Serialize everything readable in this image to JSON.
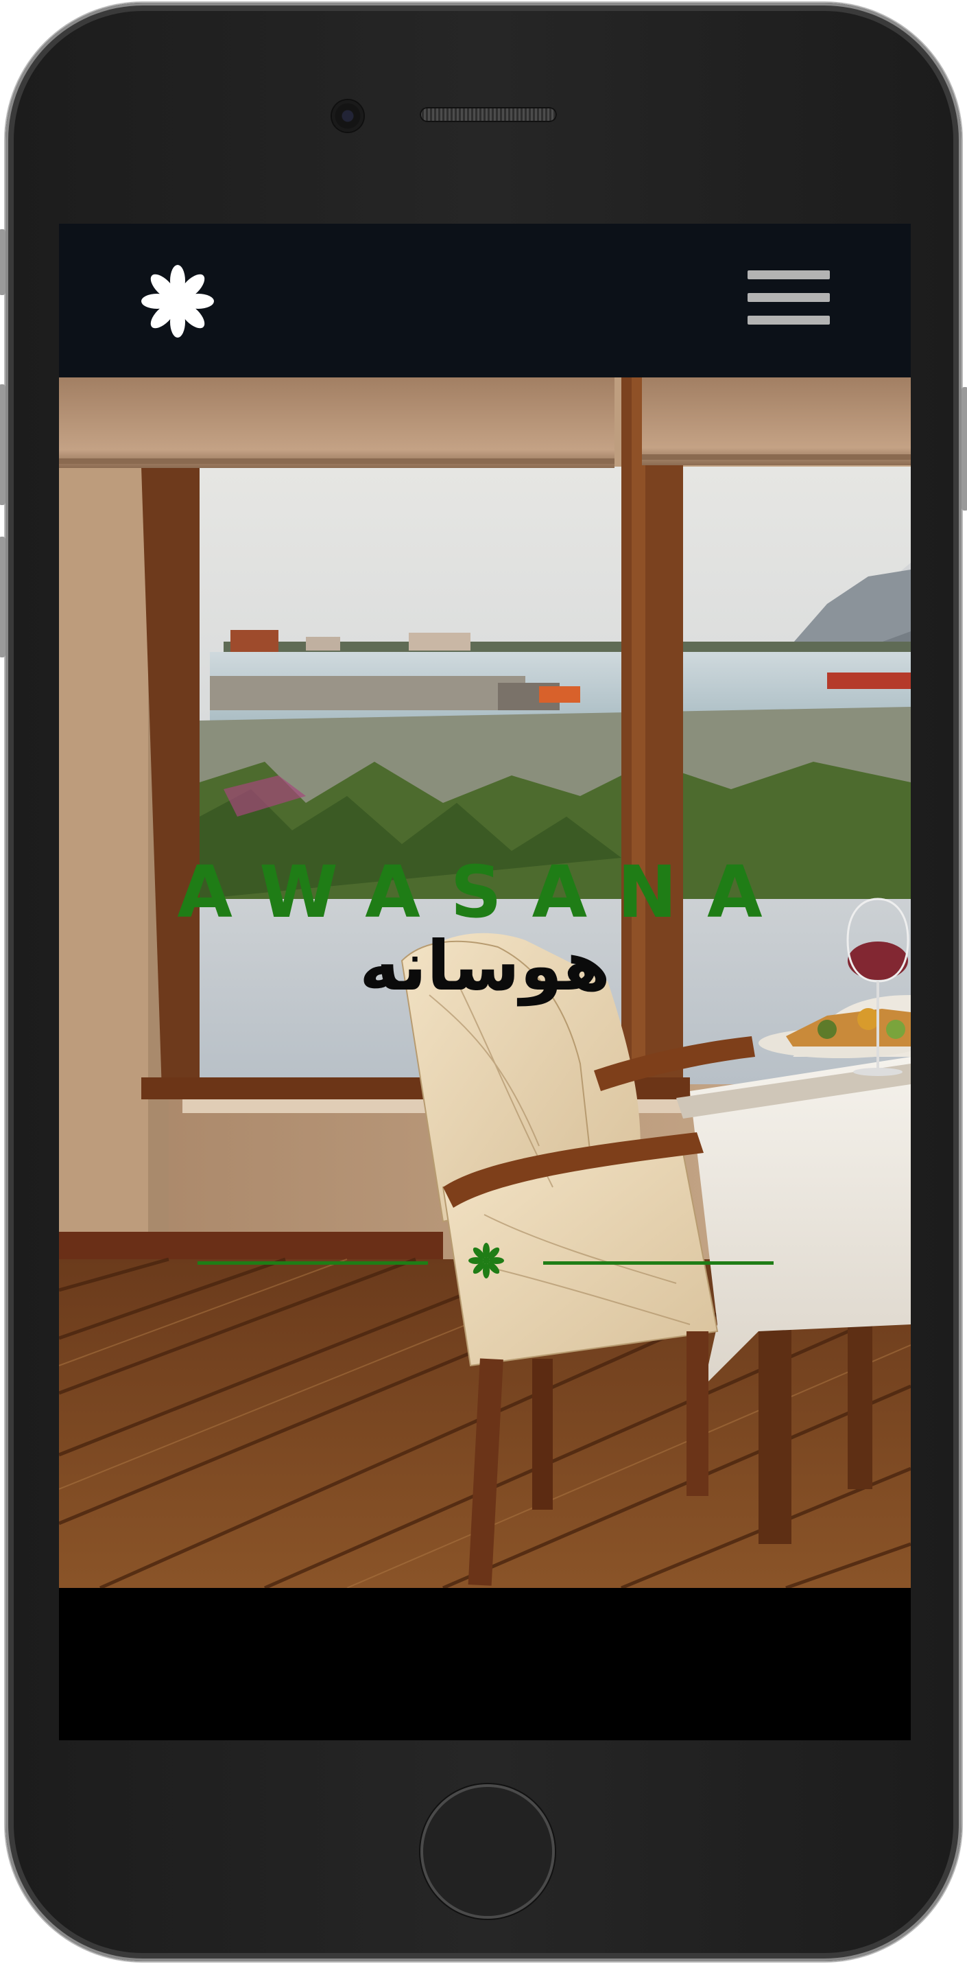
{
  "header": {
    "logo_icon": "asterisk-flower-icon",
    "menu_icon": "hamburger-menu-icon"
  },
  "hero": {
    "title": "AWASANA",
    "subtitle": "هوسانه",
    "divider_icon": "asterisk-icon",
    "background_image": "restaurant-dining-chair-window-harbor-view"
  },
  "colors": {
    "accent": "#1f7d16",
    "navbar": "#0c1118",
    "logo": "#ffffff",
    "subtitle": "#0b0b0b"
  }
}
